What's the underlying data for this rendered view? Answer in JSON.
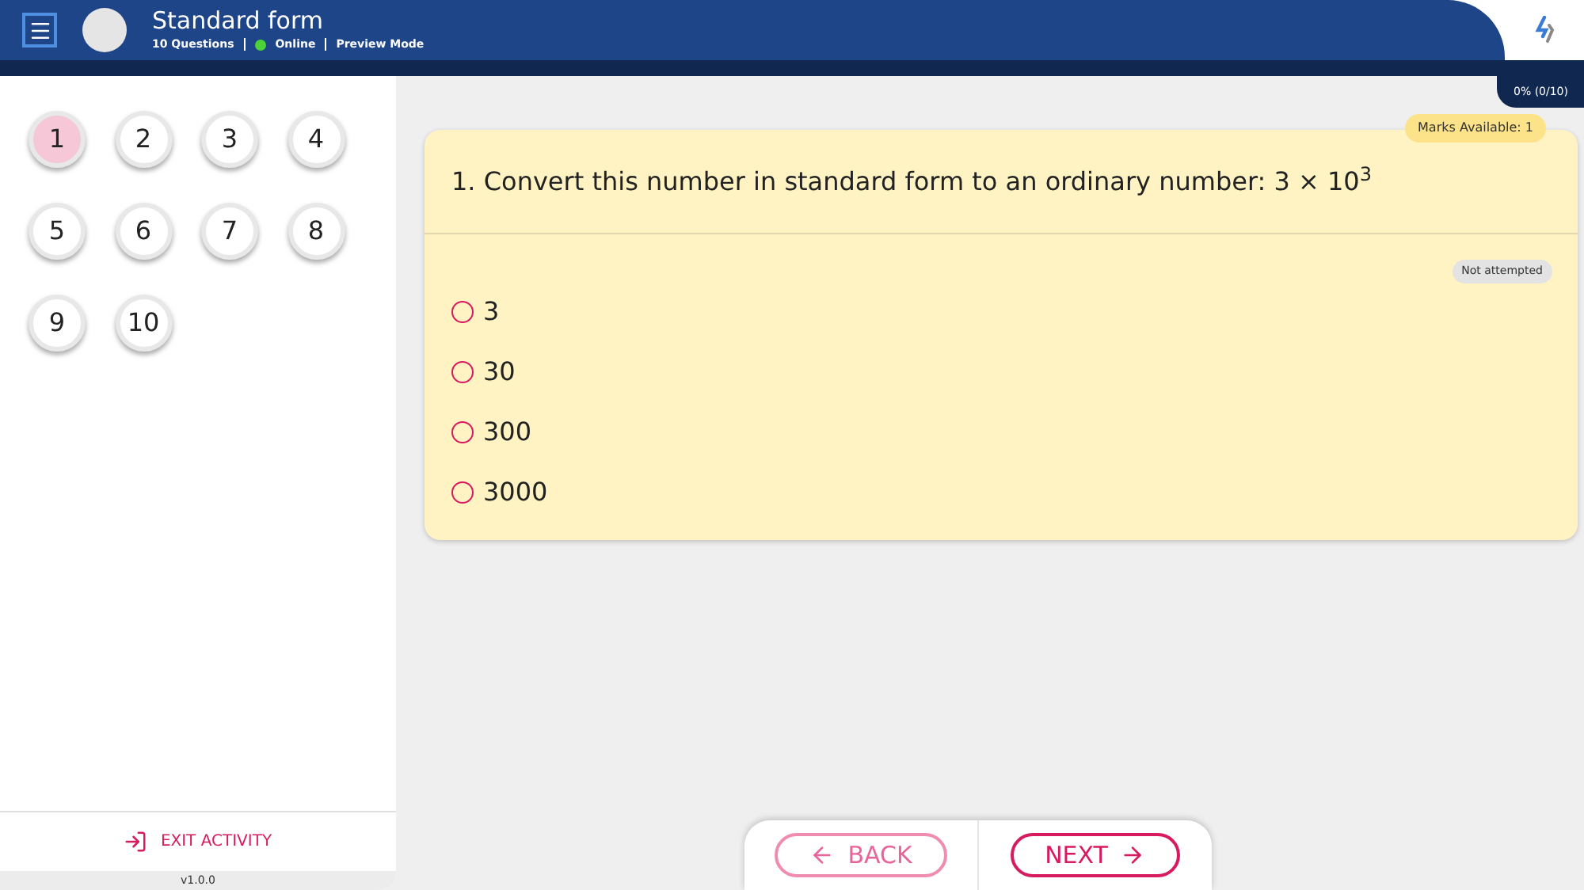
{
  "header": {
    "title": "Standard form",
    "questions_count": "10 Questions",
    "status": {
      "label": "Online",
      "online": true
    },
    "mode": "Preview Mode"
  },
  "progress": "0% (0/10)",
  "questions": [
    {
      "label": "1",
      "selected": true
    },
    {
      "label": "2",
      "selected": false
    },
    {
      "label": "3",
      "selected": false
    },
    {
      "label": "4",
      "selected": false
    },
    {
      "label": "5",
      "selected": false
    },
    {
      "label": "6",
      "selected": false
    },
    {
      "label": "7",
      "selected": false
    },
    {
      "label": "8",
      "selected": false
    },
    {
      "label": "9",
      "selected": false
    },
    {
      "label": "10",
      "selected": false
    }
  ],
  "exit": "EXIT ACTIVITY",
  "version": "v1.0.0",
  "card": {
    "marks": "Marks Available: 1",
    "question": "1. Convert this number in standard form to an ordinary number: 3 × 10$^{3}$",
    "status": "Not attempted",
    "options": [
      {
        "label": "3",
        "selected": false
      },
      {
        "label": "30",
        "selected": false
      },
      {
        "label": "300",
        "selected": false
      },
      {
        "label": "3000",
        "selected": false
      }
    ]
  },
  "nav": {
    "back": {
      "label": "BACK",
      "disabled": true
    },
    "next": {
      "label": "NEXT",
      "disabled": false
    }
  }
}
